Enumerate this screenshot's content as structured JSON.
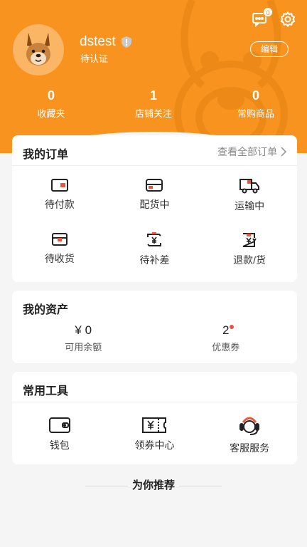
{
  "header": {
    "message_count": "0",
    "username": "dstest",
    "verify_status": "待认证",
    "edit_label": "编辑",
    "stats": [
      {
        "value": "0",
        "label": "收藏夹"
      },
      {
        "value": "1",
        "label": "店铺关注"
      },
      {
        "value": "0",
        "label": "常购商品"
      }
    ]
  },
  "orders": {
    "title": "我的订单",
    "view_all": "查看全部订单",
    "items": [
      {
        "label": "待付款",
        "icon": "wallet-icon"
      },
      {
        "label": "配货中",
        "icon": "box-icon"
      },
      {
        "label": "运输中",
        "icon": "truck-icon"
      },
      {
        "label": "待收货",
        "icon": "package-icon"
      },
      {
        "label": "待补差",
        "icon": "yen-refresh-icon"
      },
      {
        "label": "退款/货",
        "icon": "refund-icon"
      }
    ]
  },
  "assets": {
    "title": "我的资产",
    "balance_value": "¥ 0",
    "balance_label": "可用余额",
    "coupon_value": "2",
    "coupon_label": "优惠券"
  },
  "tools": {
    "title": "常用工具",
    "items": [
      {
        "label": "钱包",
        "icon": "wallet-icon"
      },
      {
        "label": "领券中心",
        "icon": "coupon-icon"
      },
      {
        "label": "客服服务",
        "icon": "customer-service-icon"
      }
    ]
  },
  "recommend_title": "为你推荐",
  "colors": {
    "accent": "#f7931e",
    "background": "#f5f5f5",
    "badge_red": "#f04b4b"
  }
}
